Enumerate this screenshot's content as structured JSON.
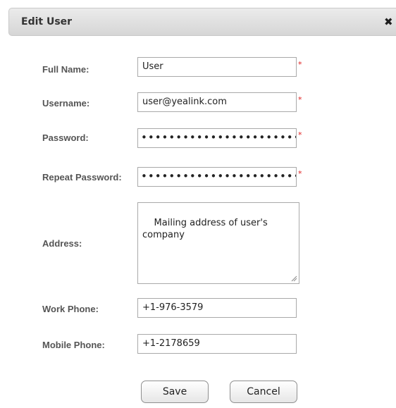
{
  "dialog": {
    "title": "Edit User",
    "close_symbol": "✖"
  },
  "form": {
    "full_name": {
      "label": "Full Name:",
      "value": "User",
      "required_mark": "*"
    },
    "username": {
      "label": "Username:",
      "value": "user@yealink.com",
      "required_mark": "*"
    },
    "password": {
      "label": "Password:",
      "value": "•••••••••••••••••••••••••••••",
      "required_mark": "*"
    },
    "repeat_password": {
      "label": "Repeat Password:",
      "value": "•••••••••••••••••••••••••••••",
      "required_mark": "*"
    },
    "address": {
      "label": "Address:",
      "value": "Mailing address of user's\ncompany"
    },
    "work_phone": {
      "label": "Work Phone:",
      "value": "+1-976-3579"
    },
    "mobile_phone": {
      "label": "Mobile Phone:",
      "value": "+1-2178659"
    }
  },
  "buttons": {
    "save": "Save",
    "cancel": "Cancel"
  },
  "colors": {
    "required_mark": "#e02020",
    "label_text": "#555555",
    "titlebar": "#dcdcdc"
  }
}
